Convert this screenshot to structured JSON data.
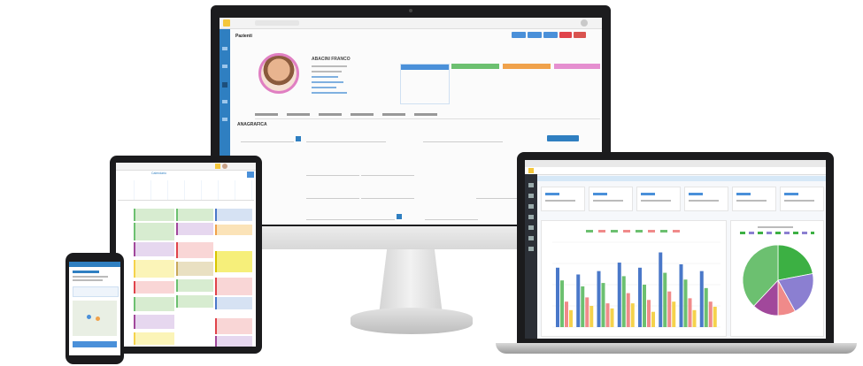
{
  "monitor": {
    "app": {
      "page_title": "Pazienti",
      "patient_name": "ABACINI FRANCO",
      "toolbar_buttons": [
        {
          "color": "#4a90d9"
        },
        {
          "color": "#4a90d9"
        },
        {
          "color": "#4a90d9"
        },
        {
          "color": "#e0434b"
        },
        {
          "color": "#d9534f"
        }
      ],
      "panels": [
        {
          "color": "#4a90d9"
        },
        {
          "color": "#6cc070"
        },
        {
          "color": "#f0a24b"
        },
        {
          "color": "#e58fd0"
        }
      ],
      "section_title": "ANAGRAFICA"
    }
  },
  "laptop": {
    "app": {
      "kpi_cards": [
        "",
        "",
        "",
        "",
        "",
        ""
      ],
      "bar_chart": {
        "series_colors": [
          "#4a78c9",
          "#6cc070",
          "#f08a8a",
          "#f5d24b"
        ],
        "values": [
          [
            70,
            55,
            30,
            20
          ],
          [
            62,
            48,
            35,
            25
          ],
          [
            66,
            52,
            28,
            22
          ],
          [
            76,
            60,
            40,
            28
          ],
          [
            70,
            50,
            32,
            18
          ],
          [
            88,
            64,
            42,
            30
          ],
          [
            74,
            56,
            34,
            20
          ],
          [
            66,
            46,
            30,
            24
          ]
        ]
      },
      "pie_chart": {
        "colors": [
          "#3cb043",
          "#8b7fd1",
          "#f08a8a",
          "#a1489b",
          "#6cc070"
        ],
        "values": [
          22,
          20,
          8,
          12,
          38
        ]
      }
    }
  },
  "tablet": {
    "app": {
      "tab_active": "Calendario"
    }
  },
  "phone": {
    "app": {}
  }
}
